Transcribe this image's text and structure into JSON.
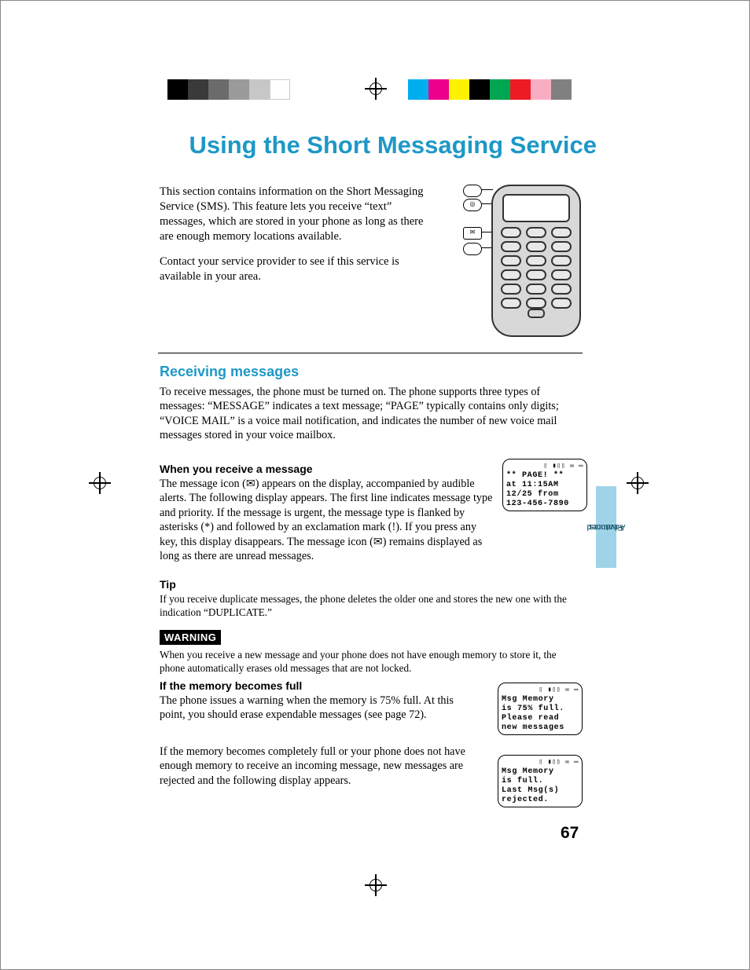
{
  "printer_marks": {
    "grayscale": [
      "#000000",
      "#3a3a3a",
      "#6b6b6b",
      "#9a9a9a",
      "#c7c7c7",
      "#ffffff"
    ],
    "color": [
      "#00AEEF",
      "#EC008C",
      "#FFF200",
      "#000000",
      "#00A651",
      "#ED1C24",
      "#F7AEC3",
      "#808080"
    ]
  },
  "title": "Using the Short Messaging Service",
  "intro": {
    "p1": "This section contains information on the Short Messaging Service (SMS). This feature lets you receive “text” messages, which are stored in your phone as long as there are enough memory locations available.",
    "p2": "Contact your service provider to see if this service is available in your area."
  },
  "section_receive": {
    "heading": "Receiving messages",
    "body": "To receive messages, the phone must be turned on. The phone supports three types of messages: “MESSAGE” indicates a text message; “PAGE” typically contains only digits; “VOICE MAIL” is a voice mail notification, and indicates the number of new voice mail messages stored in your voice mailbox."
  },
  "section_when": {
    "heading": "When you receive a message",
    "body": "The message icon (✉) appears on the display, accompanied by audible alerts. The following display appears. The first line indicates message type and priority. If the message is urgent, the message type is flanked by asterisks (*) and followed by an exclamation mark (!). If you press any key, this display disappears. The message icon (✉) remains displayed as long as there are unread messages.",
    "tip_heading": "Tip",
    "tip_body": "If you receive duplicate messages, the phone deletes the older one and stores the new one with the indication “DUPLICATE.”",
    "warning_label": "WARNING",
    "warning_body": "When you receive a new message and your phone does not have enough memory to store it, the phone automatically erases old messages that are not locked."
  },
  "section_full": {
    "heading": "If the memory becomes full",
    "p1": "The phone issues a warning when the memory is 75% full. At this point, you should erase expendable messages (see page 72).",
    "p2": "If the memory becomes completely full or your phone does not have enough memory to receive an incoming message, new messages are rejected and the following display appears."
  },
  "lcd": {
    "l1": [
      "** PAGE! **",
      "at 11:15AM",
      "12/25 from",
      "123-456-7890"
    ],
    "l2": [
      "Msg Memory",
      "is 75% full.",
      "Please read",
      "new messages"
    ],
    "l3": [
      "Msg Memory",
      "is full.",
      "Last Msg(s)",
      "rejected."
    ]
  },
  "tab": {
    "line1": "Advanced",
    "line2": "Features"
  },
  "page_number": "67"
}
